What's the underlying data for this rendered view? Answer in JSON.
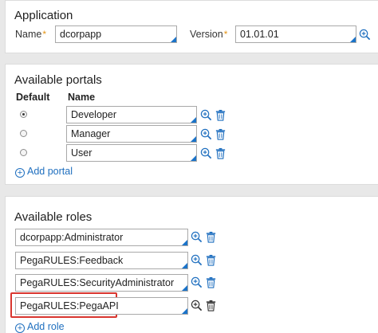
{
  "application": {
    "title": "Application",
    "name_label": "Name",
    "name_value": "dcorpapp",
    "version_label": "Version",
    "version_value": "01.01.01",
    "required_mark": "*"
  },
  "portals": {
    "title": "Available portals",
    "col_default": "Default",
    "col_name": "Name",
    "rows": [
      {
        "name": "Developer",
        "default": true
      },
      {
        "name": "Manager",
        "default": false
      },
      {
        "name": "User",
        "default": false
      }
    ],
    "add_label": "Add portal"
  },
  "roles": {
    "title": "Available roles",
    "rows": [
      {
        "name": "dcorpapp:Administrator"
      },
      {
        "name": "PegaRULES:Feedback"
      },
      {
        "name": "PegaRULES:SecurityAdministrator"
      },
      {
        "name": "PegaRULES:PegaAPI",
        "highlighted": true
      }
    ],
    "add_label": "Add role"
  },
  "colors": {
    "accent": "#1a73c9",
    "required": "#e59517",
    "highlight": "#d9362f"
  },
  "icons": {
    "zoom": "magnifier-plus-icon",
    "delete": "trash-icon",
    "add": "circle-plus-icon"
  }
}
